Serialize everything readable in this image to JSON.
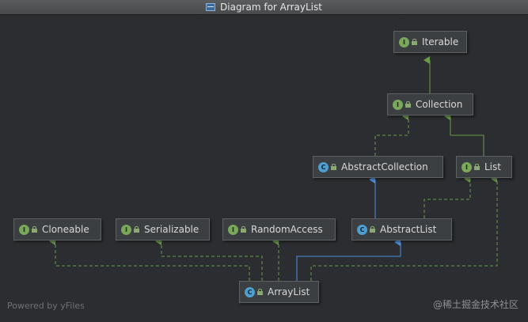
{
  "window": {
    "title": "Diagram for ArrayList"
  },
  "nodes": {
    "iterable": {
      "label": "Iterable",
      "kind": "interface"
    },
    "collection": {
      "label": "Collection",
      "kind": "interface"
    },
    "abstract_collection": {
      "label": "AbstractCollection",
      "kind": "class"
    },
    "list": {
      "label": "List",
      "kind": "interface"
    },
    "cloneable": {
      "label": "Cloneable",
      "kind": "interface"
    },
    "serializable": {
      "label": "Serializable",
      "kind": "interface"
    },
    "random_access": {
      "label": "RandomAccess",
      "kind": "interface"
    },
    "abstract_list": {
      "label": "AbstractList",
      "kind": "class"
    },
    "array_list": {
      "label": "ArrayList",
      "kind": "class"
    }
  },
  "badges": {
    "interface": "I",
    "class": "C"
  },
  "footer": {
    "powered_by": "Powered by yFiles",
    "watermark": "@稀土掘金技术社区"
  },
  "colors": {
    "implements_edge": "#6a9a4c",
    "extends_edge": "#4f8fe0"
  }
}
